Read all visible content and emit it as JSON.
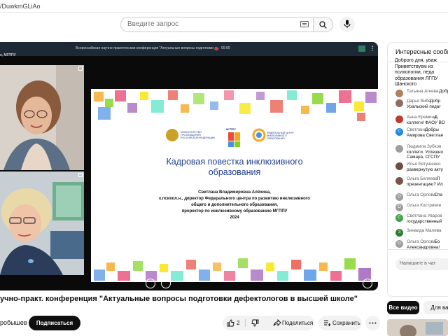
{
  "browser": {
    "url_fragment": "/DuwkmGLiAo"
  },
  "search": {
    "placeholder": "Введите запрос"
  },
  "player": {
    "conference_header": "Всероссийская научно-практическая конференция \"Актуальные вопросы подготовки д...",
    "rec_time": "00:00",
    "speaker_label": "o, МГППУ",
    "slide": {
      "logo_ministry_text": "МИНИСТЕРСТВО ПРОСВЕЩЕНИЯ РОССИЙСКОЙ ФЕДЕРАЦИИ",
      "logo_mgppu_text": "МГППУ",
      "logo_center_text": "ФЕДЕРАЛЬНЫЙ ЦЕНТР ИНКЛЮЗИВНОГО ОБРАЗОВАНИЯ",
      "title_line1": "Кадровая повестка инклюзивного",
      "title_line2": "образования",
      "author_line1": "Светлана Владимировна Алёхина,",
      "author_line2": "к.психол.н., директор Федерального центра по развитию инклюзивного",
      "author_line3": "общего и дополнительного образования,",
      "author_line4": "проректор по инклюзивному образованию МГППУ",
      "author_line5": "2024"
    }
  },
  "video": {
    "title": "учно-практ. конференция \"Актуальные вопросы подготовки дефектологов в высшей школе\"",
    "channel": "робышев",
    "subscribe_label": "Подписаться",
    "likes": "2",
    "share_label": "Поделиться",
    "save_label": "Сохранить"
  },
  "chat": {
    "header": "Интересные сообщения",
    "pinned": [
      "Доброго дня, уваж",
      "Приветствуем из",
      "психологии, педа",
      "образования ЛГПУ",
      "Шанского"
    ],
    "messages": [
      {
        "author": "Татьяна Агеева",
        "text": "Добр",
        "avatar_letter": "",
        "avatar_color": "#b08060"
      },
      {
        "author": "Дарья Вибе",
        "text": "Добр",
        "line2": "Уральский педаг",
        "avatar_letter": "",
        "avatar_color": "#8d6e63"
      },
      {
        "author": "Анна Еремина",
        "text": "Д",
        "line2": "коллеги! ФАОУ ВО",
        "avatar_letter": "",
        "avatar_color": "#c0392b"
      },
      {
        "author": "Светлана",
        "text": "Добры",
        "line2": "Амирова Светлан",
        "avatar_letter": "С",
        "avatar_color": "#1e88e5"
      },
      {
        "author": "Людмила Зубков",
        "text": "",
        "line2": "коллеги. Успешно",
        "line3": "Самара, СГСПУ",
        "avatar_letter": "",
        "avatar_color": "#9e9e9e"
      },
      {
        "author": "Илья Евтушенко",
        "text": "",
        "line2": "развернутую акту",
        "avatar_letter": "",
        "avatar_color": "#6d4c41"
      },
      {
        "author": "Ольга Беляева",
        "text": "П",
        "line2": "презентацию? Ил",
        "avatar_letter": "",
        "avatar_color": "#795548"
      },
      {
        "author": "Ольга Орлова",
        "text": "Спа",
        "avatar_letter": "О",
        "avatar_color": "#9e9e9e"
      },
      {
        "author": "Ольга Кострикин",
        "text": "",
        "avatar_letter": "О",
        "avatar_color": "#9e9e9e"
      },
      {
        "author": "Светлана Уваров",
        "text": "",
        "line2": "государственный",
        "avatar_letter": "С",
        "avatar_color": "#43a047"
      },
      {
        "author": "Зинаида Малева",
        "text": "",
        "avatar_letter": "З",
        "avatar_color": "#2e7d32"
      },
      {
        "author": "Ольга Орлова",
        "text": "Бо",
        "line2": "Александровна!",
        "avatar_letter": "О",
        "avatar_color": "#9e9e9e"
      }
    ],
    "input_placeholder": "Напишите в чат"
  },
  "recommendations": {
    "chip_all": "Все видео",
    "chip_for_you": "Для вас"
  },
  "colors": {
    "subscribe_bg": "#0f0f0f",
    "slide_title": "#1e3d8a",
    "player_bg": "#0a0a0a"
  }
}
